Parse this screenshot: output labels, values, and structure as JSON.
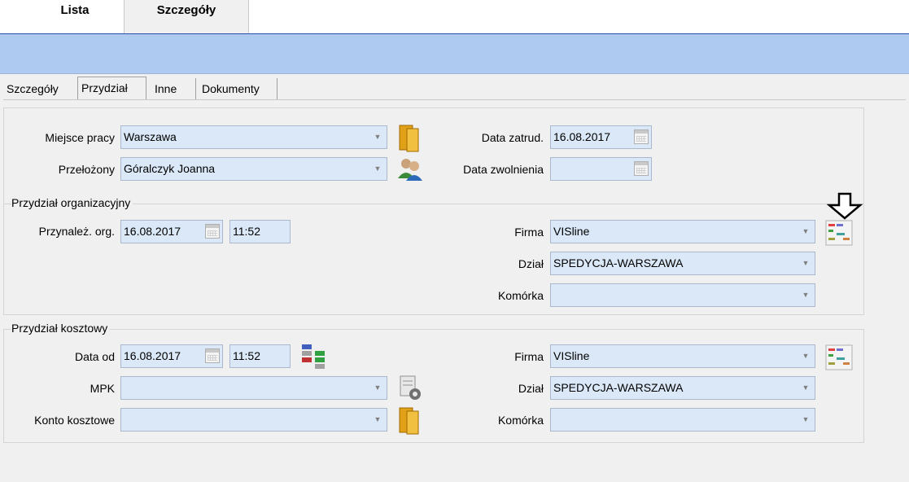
{
  "top_tabs": {
    "lista": "Lista",
    "szczegoly": "Szczegóły"
  },
  "sub_tabs": [
    "Szczegóły",
    "Przydział",
    "Inne",
    "Dokumenty"
  ],
  "general": {
    "miejsce_pracy_label": "Miejsce pracy",
    "miejsce_pracy_value": "Warszawa",
    "przelozony_label": "Przełożony",
    "przelozony_value": "Góralczyk Joanna",
    "data_zatrud_label": "Data zatrud.",
    "data_zatrud_value": "16.08.2017",
    "data_zwolnienia_label": "Data zwolnienia",
    "data_zwolnienia_value": ""
  },
  "org": {
    "title": "Przydział organizacyjny",
    "przynalez_label": "Przynależ. org.",
    "date": "16.08.2017",
    "time": "11:52",
    "firma_label": "Firma",
    "firma_value": "VISline",
    "dzial_label": "Dział",
    "dzial_value": "SPEDYCJA-WARSZAWA",
    "komorka_label": "Komórka",
    "komorka_value": ""
  },
  "cost": {
    "title": "Przydział kosztowy",
    "data_od_label": "Data od",
    "date": "16.08.2017",
    "time": "11:52",
    "mpk_label": "MPK",
    "mpk_value": "",
    "konto_label": "Konto kosztowe",
    "konto_value": "",
    "firma_label": "Firma",
    "firma_value": "VISline",
    "dzial_label": "Dział",
    "dzial_value": "SPEDYCJA-WARSZAWA",
    "komorka_label": "Komórka",
    "komorka_value": ""
  },
  "colors": {
    "field_bg": "#dbe8f7",
    "header_bar": "#aecaf0"
  },
  "icons": [
    "folder-icon",
    "people-icon",
    "calendar-icon",
    "org-structure-icon",
    "transfer-icon",
    "mpk-settings-icon",
    "down-arrow-icon"
  ]
}
